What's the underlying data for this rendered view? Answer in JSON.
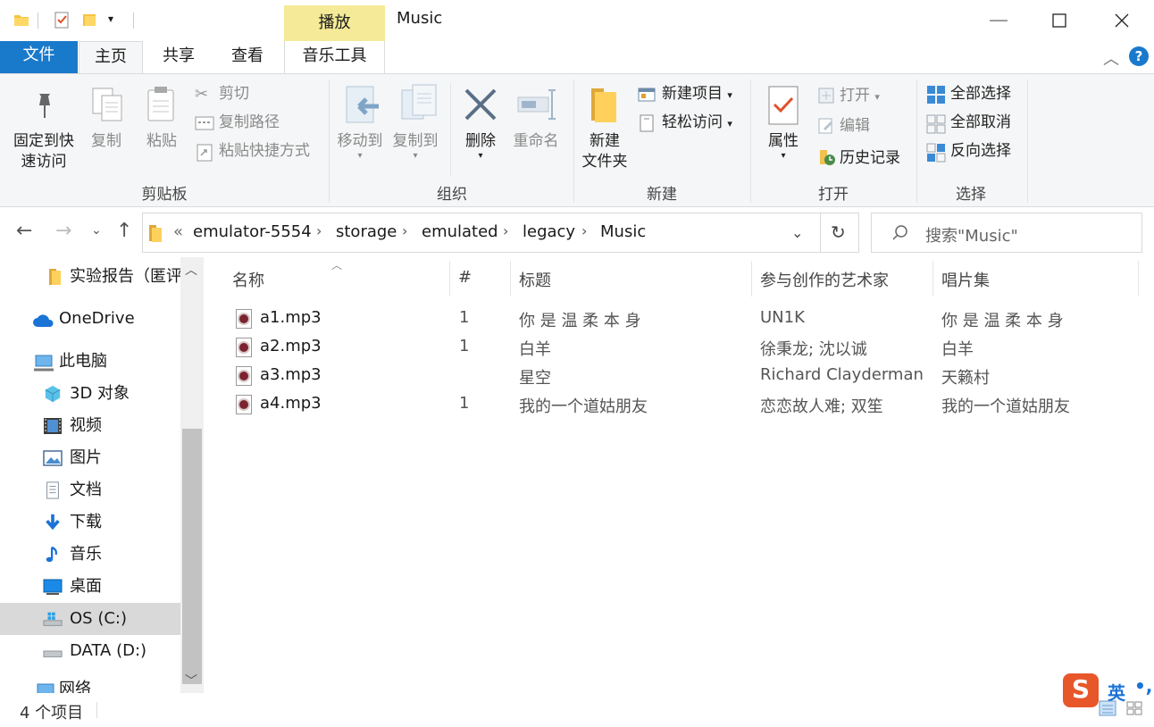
{
  "window": {
    "title": "Music",
    "context_tab": "播放"
  },
  "tabs": {
    "file": "文件",
    "home": "主页",
    "share": "共享",
    "view": "查看",
    "music_tools": "音乐工具"
  },
  "ribbon": {
    "clipboard": {
      "label": "剪贴板",
      "pin_line1": "固定到快",
      "pin_line2": "速访问",
      "copy": "复制",
      "paste": "粘贴",
      "cut": "剪切",
      "copy_path": "复制路径",
      "paste_shortcut": "粘贴快捷方式"
    },
    "organize": {
      "label": "组织",
      "move_to": "移动到",
      "copy_to": "复制到",
      "delete": "删除",
      "rename": "重命名"
    },
    "new": {
      "label": "新建",
      "new_folder_line1": "新建",
      "new_folder_line2": "文件夹",
      "new_item": "新建项目",
      "easy_access": "轻松访问"
    },
    "open": {
      "label": "打开",
      "properties": "属性",
      "open": "打开",
      "edit": "编辑",
      "history": "历史记录"
    },
    "select": {
      "label": "选择",
      "select_all": "全部选择",
      "select_none": "全部取消",
      "invert": "反向选择"
    }
  },
  "address": {
    "overflow": "«",
    "crumbs": [
      "emulator-5554",
      "storage",
      "emulated",
      "legacy",
      "Music"
    ],
    "search_placeholder": "搜索\"Music\""
  },
  "nav": {
    "items": [
      {
        "label": "实验报告（匿评",
        "icon": "folder-icon"
      },
      {
        "label": "OneDrive",
        "icon": "cloud-icon"
      },
      {
        "label": "此电脑",
        "icon": "pc-icon"
      },
      {
        "label": "3D 对象",
        "icon": "cube-icon"
      },
      {
        "label": "视频",
        "icon": "video-icon"
      },
      {
        "label": "图片",
        "icon": "picture-icon"
      },
      {
        "label": "文档",
        "icon": "document-icon"
      },
      {
        "label": "下载",
        "icon": "download-icon"
      },
      {
        "label": "音乐",
        "icon": "music-icon"
      },
      {
        "label": "桌面",
        "icon": "desktop-icon"
      },
      {
        "label": "OS (C:)",
        "icon": "drive-icon"
      },
      {
        "label": "DATA (D:)",
        "icon": "drive-icon"
      },
      {
        "label": "网络",
        "icon": "network-icon"
      }
    ]
  },
  "list": {
    "columns": [
      "名称",
      "#",
      "标题",
      "参与创作的艺术家",
      "唱片集"
    ],
    "rows": [
      {
        "name": "a1.mp3",
        "num": "1",
        "title": "你 是 温 柔 本 身",
        "artist": "UN1K",
        "album": "你 是 温 柔 本 身"
      },
      {
        "name": "a2.mp3",
        "num": "1",
        "title": "白羊",
        "artist": "徐秉龙; 沈以诚",
        "album": "白羊"
      },
      {
        "name": "a3.mp3",
        "num": "",
        "title": "星空",
        "artist": "Richard Clayderman",
        "album": "天籁村"
      },
      {
        "name": "a4.mp3",
        "num": "1",
        "title": "我的一个道姑朋友",
        "artist": "恋恋故人难; 双笙",
        "album": "我的一个道姑朋友"
      }
    ]
  },
  "status": {
    "count": "4 个项目"
  },
  "ime": {
    "label": "英"
  },
  "colors": {
    "accent": "#1979ca",
    "context_tab": "#f4ea97",
    "selected": "#d9d9d9"
  }
}
